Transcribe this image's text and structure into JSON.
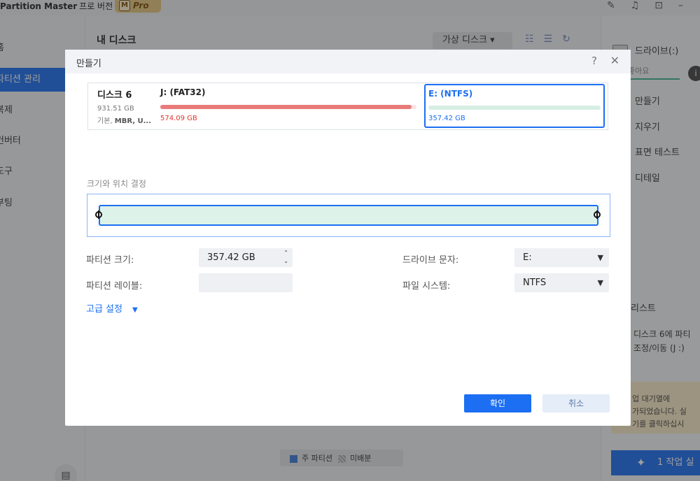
{
  "app": {
    "title": "Partition Master",
    "subtitle": "프로 버전",
    "badge": "Pro",
    "badge_logo": "M"
  },
  "left_nav": {
    "items": [
      {
        "label": "홈",
        "active": false
      },
      {
        "label": "파티션 관리",
        "active": true
      },
      {
        "label": "복제",
        "active": false
      },
      {
        "label": "컨버터",
        "active": false
      },
      {
        "label": "도구",
        "active": false
      },
      {
        "label": "부팅",
        "active": false
      }
    ]
  },
  "main": {
    "title": "내 디스크",
    "virtual_disk": "가상 디스크"
  },
  "legend": {
    "primary": "주 파티션",
    "unallocated": "미배분"
  },
  "right_panel": {
    "drive": "드라이브(:)",
    "health": "좋아요",
    "ops": [
      "만들기",
      "지우기",
      "표면 테스트",
      "디테일"
    ],
    "list_title": "리스트",
    "task_line1": "디스크 6에 파티",
    "task_line2": "조정/이동 (J :)",
    "notice_line1": "업 대기열에",
    "notice_line2": "가되었습니다. 실",
    "notice_line3": "기를 클릭하십시",
    "execute": "1 작업 실"
  },
  "dialog": {
    "title": "만들기",
    "disk": {
      "name": "디스크 6",
      "size": "931.51 GB",
      "type_prefix": "기본, ",
      "type_bold": "MBR, U..."
    },
    "partition_j": {
      "label": "J: (FAT32)",
      "size": "574.09 GB",
      "color": "#e97a7a",
      "fill": 0.98
    },
    "partition_e": {
      "label": "E: (NTFS)",
      "size": "357.42 GB",
      "color": "#1c6ff2"
    },
    "size_caption": "크기와 위치 결정",
    "fields": {
      "partition_size_label": "파티션 크기:",
      "partition_size_value": "357.42 GB",
      "partition_label_label": "파티션 레이블:",
      "partition_label_value": "",
      "drive_letter_label": "드라이브 문자:",
      "drive_letter_value": "E:",
      "fs_label": "파일 시스템:",
      "fs_value": "NTFS"
    },
    "advanced": "고급 설정",
    "ok": "확인",
    "cancel": "취소"
  }
}
